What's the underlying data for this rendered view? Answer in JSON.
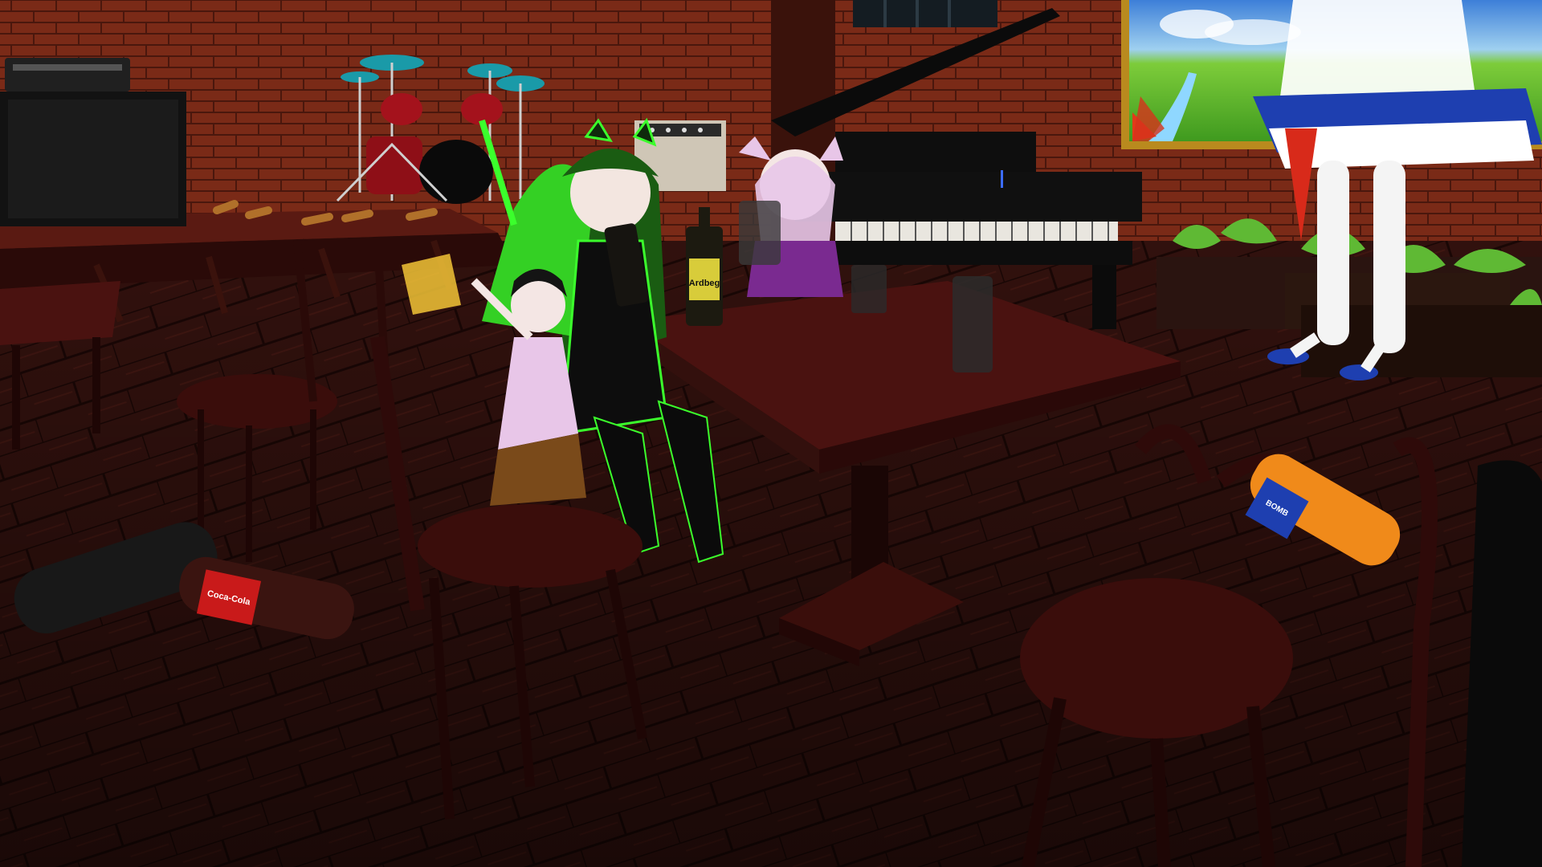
{
  "scene": {
    "title": "",
    "whisky_label": "Ardbeg",
    "orange_label": "BOMB",
    "soda_label": "Coca-Cola"
  },
  "colors": {
    "brick": "#7a2a17",
    "floor": "#3a1410",
    "table": "#3f0f0c",
    "chair": "#2e0a09",
    "green_accent": "#3bff2c",
    "pink_accent": "#e8c6e8",
    "blue_accent": "#1e3fb0"
  },
  "icons": [
    "drum-kit-icon",
    "amplifier-icon",
    "grand-piano-icon",
    "landscape-painting-icon",
    "plant-icon"
  ]
}
